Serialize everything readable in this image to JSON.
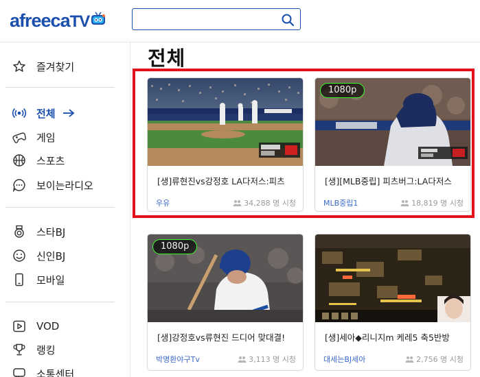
{
  "header": {
    "logo_text": "afreeca",
    "logo_suffix": "TV",
    "search": {
      "value": "",
      "placeholder": ""
    }
  },
  "sidebar": {
    "items": [
      {
        "label": "즐겨찾기",
        "icon": "star-icon"
      },
      {
        "label": "전체",
        "icon": "broadcast-icon",
        "active": true
      },
      {
        "label": "게임",
        "icon": "gamepad-icon"
      },
      {
        "label": "스포츠",
        "icon": "basketball-icon"
      },
      {
        "label": "보이는라디오",
        "icon": "chat-bubble-icon"
      },
      {
        "label": "스타BJ",
        "icon": "medal-icon"
      },
      {
        "label": "신인BJ",
        "icon": "smile-icon"
      },
      {
        "label": "모바일",
        "icon": "mobile-icon"
      },
      {
        "label": "VOD",
        "icon": "play-icon"
      },
      {
        "label": "랭킹",
        "icon": "trophy-icon"
      },
      {
        "label": "소통센터",
        "icon": "speech-icon"
      }
    ]
  },
  "main": {
    "title": "전체",
    "highlight_color": "#e3111a",
    "cards": [
      {
        "title": "[생]류현진vs강정호 LA다저스:피츠",
        "bj": "우유",
        "viewers": "34,288 명 시청",
        "badge": ""
      },
      {
        "title": "[생][MLB중립] 피츠버그:LA다저스",
        "bj": "MLB중립1",
        "viewers": "18,819 명 시청",
        "badge": "1080p"
      },
      {
        "title": "[생]강정호vs류현진 드디어 맞대결!",
        "bj": "박명환야구Tv",
        "viewers": "3,113 명 시청",
        "badge": "1080p"
      },
      {
        "title": "[생]세아◆리니지m 케레5 축5반방",
        "bj": "대세는BJ세아",
        "viewers": "2,756 명 시청",
        "badge": ""
      }
    ]
  },
  "colors": {
    "brand": "#1a4fae",
    "badge_border": "#37ff2f",
    "bj_link": "#3a69c8"
  }
}
